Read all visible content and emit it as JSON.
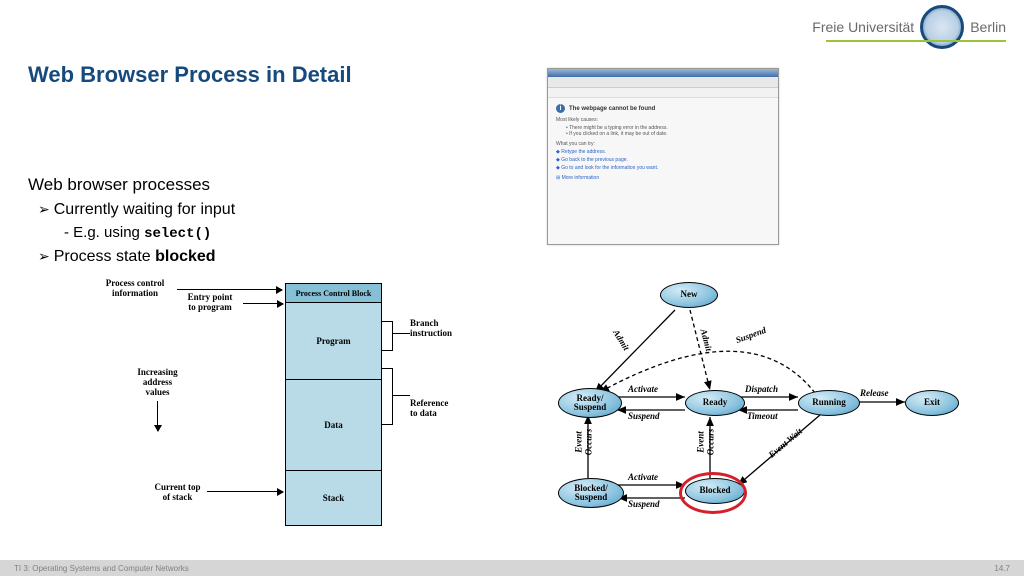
{
  "header": {
    "university_left": "Freie Universität",
    "university_right": "Berlin"
  },
  "title": "Web Browser Process in Detail",
  "body": {
    "heading": "Web browser processes",
    "b1": "Currently waiting for input",
    "b1_sub_prefix": "E.g. using ",
    "b1_sub_code": "select()",
    "b2_prefix": "Process state ",
    "b2_bold": "blocked"
  },
  "browser": {
    "error_title": "The webpage cannot be found",
    "line1": "Most likely causes:",
    "li1": "There might be a typing error in the address.",
    "li2": "If you clicked on a link, it may be out of date.",
    "line2": "What you can try:",
    "link1": "Retype the address.",
    "link2": "Go back to the previous page.",
    "link3": "Go to and look for the information you want.",
    "link4": "More information"
  },
  "pcb": {
    "blocks": [
      "Process Control Block",
      "Program",
      "Data",
      "Stack"
    ],
    "labels": {
      "pci": "Process control\ninformation",
      "entry": "Entry point\nto program",
      "increasing": "Increasing\naddress\nvalues",
      "current_top": "Current top\nof stack",
      "branch": "Branch\ninstruction",
      "refdata": "Reference\nto data"
    }
  },
  "states": {
    "nodes": {
      "new": "New",
      "ready_susp": "Ready/\nSuspend",
      "ready": "Ready",
      "running": "Running",
      "exit": "Exit",
      "blocked_susp": "Blocked/\nSuspend",
      "blocked": "Blocked"
    },
    "edges": {
      "admit1": "Admit",
      "admit2": "Admit",
      "suspend_top": "Suspend",
      "activate1": "Activate",
      "suspend1": "Suspend",
      "dispatch": "Dispatch",
      "timeout": "Timeout",
      "release": "Release",
      "event_occurs1": "Event\nOccurs",
      "event_occurs2": "Event\nOccurs",
      "event_wait": "Event Wait",
      "activate2": "Activate",
      "suspend2": "Suspend"
    }
  },
  "footer": {
    "left": "TI 3: Operating Systems and Computer Networks",
    "right": "14.7"
  }
}
